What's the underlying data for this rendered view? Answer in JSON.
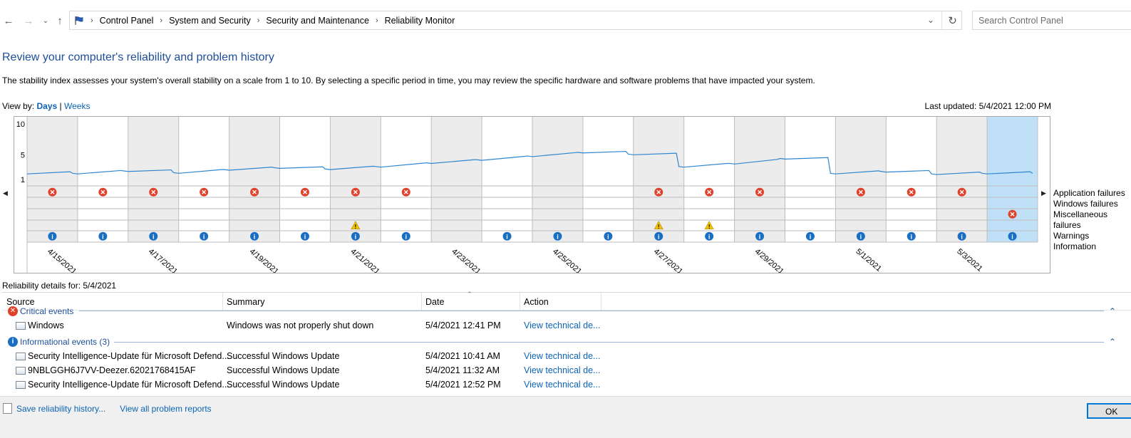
{
  "breadcrumb": {
    "items": [
      "Control Panel",
      "System and Security",
      "Security and Maintenance",
      "Reliability Monitor"
    ]
  },
  "search": {
    "placeholder": "Search Control Panel"
  },
  "page": {
    "title": "Review your computer's reliability and problem history",
    "description": "The stability index assesses your system's overall stability on a scale from 1 to 10. By selecting a specific period in time, you may review the specific hardware and software problems that have impacted your system.",
    "view_by_label": "View by:",
    "view_days": "Days",
    "view_sep": "|",
    "view_weeks": "Weeks",
    "last_updated": "Last updated: 5/4/2021 12:00 PM"
  },
  "chart_data": {
    "type": "line",
    "y_ticks": [
      "10",
      "5",
      "1"
    ],
    "ylim": [
      1,
      10
    ],
    "days": [
      "4/15/2021",
      "4/16/2021",
      "4/17/2021",
      "4/18/2021",
      "4/19/2021",
      "4/20/2021",
      "4/21/2021",
      "4/22/2021",
      "4/23/2021",
      "4/24/2021",
      "4/25/2021",
      "4/26/2021",
      "4/27/2021",
      "4/28/2021",
      "4/29/2021",
      "4/30/2021",
      "5/1/2021",
      "5/2/2021",
      "5/3/2021",
      "5/4/2021"
    ],
    "date_labels": [
      "4/15/2021",
      "4/17/2021",
      "4/19/2021",
      "4/21/2021",
      "4/23/2021",
      "4/25/2021",
      "4/27/2021",
      "4/29/2021",
      "5/1/2021",
      "5/3/2021"
    ],
    "stability_index": [
      1.9,
      1.9,
      2.3,
      2.0,
      2.5,
      2.8,
      2.6,
      3.0,
      3.6,
      4.1,
      4.7,
      5.3,
      5.0,
      3.0,
      3.5,
      4.3,
      1.9,
      2.2,
      1.8,
      1.9
    ],
    "selected_day": "5/4/2021",
    "rows": [
      "Application failures",
      "Windows failures",
      "Miscellaneous failures",
      "Warnings",
      "Information"
    ],
    "events": {
      "application_failures": [
        1,
        1,
        1,
        1,
        1,
        1,
        1,
        1,
        0,
        0,
        0,
        0,
        1,
        1,
        1,
        0,
        1,
        1,
        1,
        0
      ],
      "windows_failures": [
        0,
        0,
        0,
        0,
        0,
        0,
        0,
        0,
        0,
        0,
        0,
        0,
        0,
        0,
        0,
        0,
        0,
        0,
        0,
        0
      ],
      "misc_failures": [
        0,
        0,
        0,
        0,
        0,
        0,
        0,
        0,
        0,
        0,
        0,
        0,
        0,
        0,
        0,
        0,
        0,
        0,
        0,
        1
      ],
      "warnings": [
        0,
        0,
        0,
        0,
        0,
        0,
        1,
        0,
        0,
        0,
        0,
        0,
        1,
        1,
        0,
        0,
        0,
        0,
        0,
        0
      ],
      "information": [
        1,
        1,
        1,
        1,
        1,
        1,
        1,
        1,
        0,
        1,
        1,
        1,
        1,
        1,
        1,
        1,
        1,
        1,
        1,
        1
      ]
    }
  },
  "details": {
    "heading": "Reliability details for: 5/4/2021",
    "columns": [
      "Source",
      "Summary",
      "Date",
      "Action"
    ],
    "critical_label": "Critical events",
    "info_label": "Informational events (3)",
    "critical": [
      {
        "source": "Windows",
        "summary": "Windows was not properly shut down",
        "date": "5/4/2021 12:41 PM",
        "action": "View technical de..."
      }
    ],
    "informational": [
      {
        "source": "Security Intelligence-Update für Microsoft Defend...",
        "summary": "Successful Windows Update",
        "date": "5/4/2021 10:41 AM",
        "action": "View technical de..."
      },
      {
        "source": "9NBLGGH6J7VV-Deezer.62021768415AF",
        "summary": "Successful Windows Update",
        "date": "5/4/2021 11:32 AM",
        "action": "View technical de..."
      },
      {
        "source": "Security Intelligence-Update für Microsoft Defend...",
        "summary": "Successful Windows Update",
        "date": "5/4/2021 12:52 PM",
        "action": "View technical de..."
      }
    ]
  },
  "footer": {
    "save_history": "Save reliability history...",
    "view_all": "View all problem reports",
    "ok": "OK"
  },
  "colors": {
    "link": "#0b63b6",
    "title": "#1e4e9a",
    "line": "#2e86d0",
    "error": "#e0412b",
    "info": "#1a6fc2",
    "warning": "#f4c300",
    "selected": "#bfe0f6"
  }
}
